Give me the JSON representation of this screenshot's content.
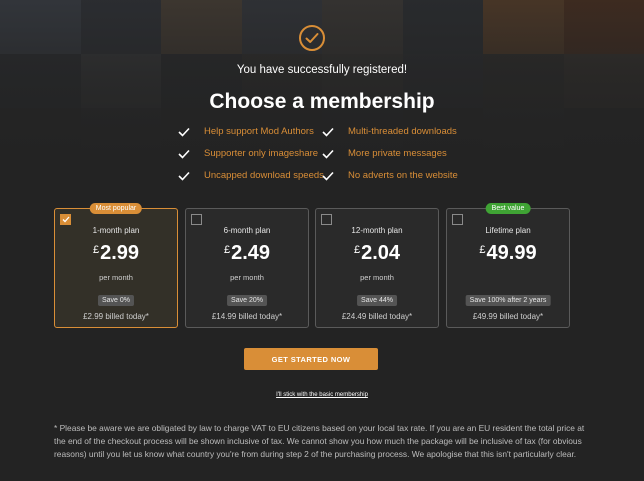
{
  "colors": {
    "accent": "#d98e37",
    "green": "#3fa334",
    "background": "#232323"
  },
  "hero": {
    "success_text": "You have successfully registered!",
    "title": "Choose a membership",
    "icon": "check-circle-icon"
  },
  "features": [
    "Help support Mod Authors",
    "Supporter only imageshare",
    "Uncapped download speeds",
    "Multi-threaded downloads",
    "More private messages",
    "No adverts on the website"
  ],
  "plans": [
    {
      "name": "1-month plan",
      "currency": "£",
      "price": "2.99",
      "per": "per month",
      "save": "Save 0%",
      "billed": "£2.99 billed today*",
      "badge": "Most popular",
      "selected": true
    },
    {
      "name": "6-month plan",
      "currency": "£",
      "price": "2.49",
      "per": "per month",
      "save": "Save 20%",
      "billed": "£14.99 billed today*",
      "badge": "",
      "selected": false
    },
    {
      "name": "12-month plan",
      "currency": "£",
      "price": "2.04",
      "per": "per month",
      "save": "Save 44%",
      "billed": "£24.49 billed today*",
      "badge": "",
      "selected": false
    },
    {
      "name": "Lifetime plan",
      "currency": "£",
      "price": "49.99",
      "per": "",
      "save": "Save 100% after 2 years",
      "billed": "£49.99 billed today*",
      "badge": "Best value",
      "selected": false
    }
  ],
  "cta_label": "GET STARTED NOW",
  "basic_link": "I'll stick with the basic membership",
  "disclaimer": "* Please be aware we are obligated by law to charge VAT to EU citizens based on your local tax rate. If you are an EU resident the total price at the end of the checkout process will be shown inclusive of tax. We cannot show you how much the package will be inclusive of tax (for obvious reasons) until you let us know what country you're from during step 2 of the purchasing process. We apologise that this isn't particularly clear."
}
